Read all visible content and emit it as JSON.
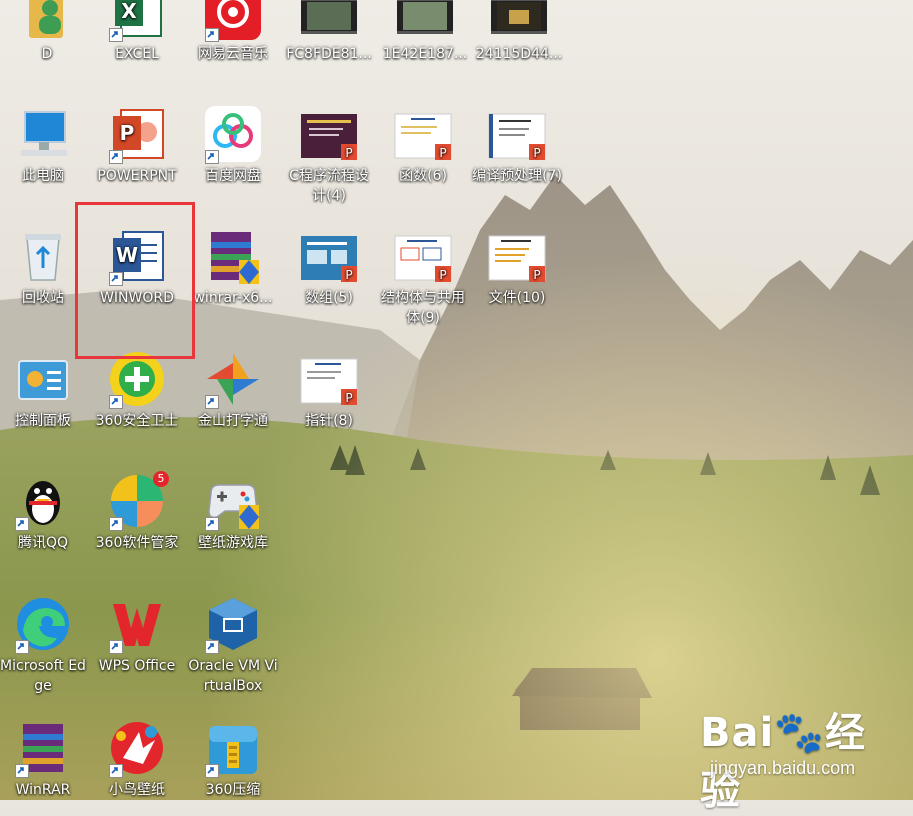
{
  "desktop": {
    "icons": [
      {
        "id": "d",
        "label": "D"
      },
      {
        "id": "excel",
        "label": "EXCEL"
      },
      {
        "id": "netease",
        "label": "网易云音乐"
      },
      {
        "id": "video1",
        "label": "FC8FDE81..."
      },
      {
        "id": "video2",
        "label": "1E42E187..."
      },
      {
        "id": "video3",
        "label": "24115D44..."
      },
      {
        "id": "thispc",
        "label": "此电脑"
      },
      {
        "id": "powerpnt",
        "label": "POWERPNT"
      },
      {
        "id": "baidunetdisk",
        "label": "百度网盘"
      },
      {
        "id": "c-flow",
        "label": "C程序流程设计(4)"
      },
      {
        "id": "func",
        "label": "函数(6)"
      },
      {
        "id": "preproc",
        "label": "编译预处理(7)"
      },
      {
        "id": "recycle",
        "label": "回收站"
      },
      {
        "id": "winword",
        "label": "WINWORD"
      },
      {
        "id": "winrar-x6",
        "label": "winrar-x6..."
      },
      {
        "id": "array",
        "label": "数组(5)"
      },
      {
        "id": "struct",
        "label": "结构体与共用体(9)"
      },
      {
        "id": "file",
        "label": "文件(10)"
      },
      {
        "id": "controlpanel",
        "label": "控制面板"
      },
      {
        "id": "360safe",
        "label": "360安全卫士"
      },
      {
        "id": "jinshan",
        "label": "金山打字通"
      },
      {
        "id": "pointer",
        "label": "指针(8)"
      },
      {
        "id": "qq",
        "label": "腾讯QQ"
      },
      {
        "id": "360manager",
        "label": "360软件管家",
        "badge": "5"
      },
      {
        "id": "gamelib",
        "label": "壁纸游戏库"
      },
      {
        "id": "edge",
        "label": "Microsoft Edge"
      },
      {
        "id": "wps",
        "label": "WPS Office"
      },
      {
        "id": "virtualbox",
        "label": "Oracle VM VirtualBox"
      },
      {
        "id": "winrar",
        "label": "WinRAR"
      },
      {
        "id": "birdwall",
        "label": "小鸟壁纸"
      },
      {
        "id": "360zip",
        "label": "360压缩"
      }
    ]
  },
  "watermark": {
    "brand": "Bai",
    "brand_suffix": "经验",
    "url": "jingyan.baidu.com"
  },
  "colors": {
    "highlight": "#e8363a",
    "word_blue": "#2b5797",
    "excel_green": "#1f7244",
    "ppt_orange": "#d24726"
  }
}
